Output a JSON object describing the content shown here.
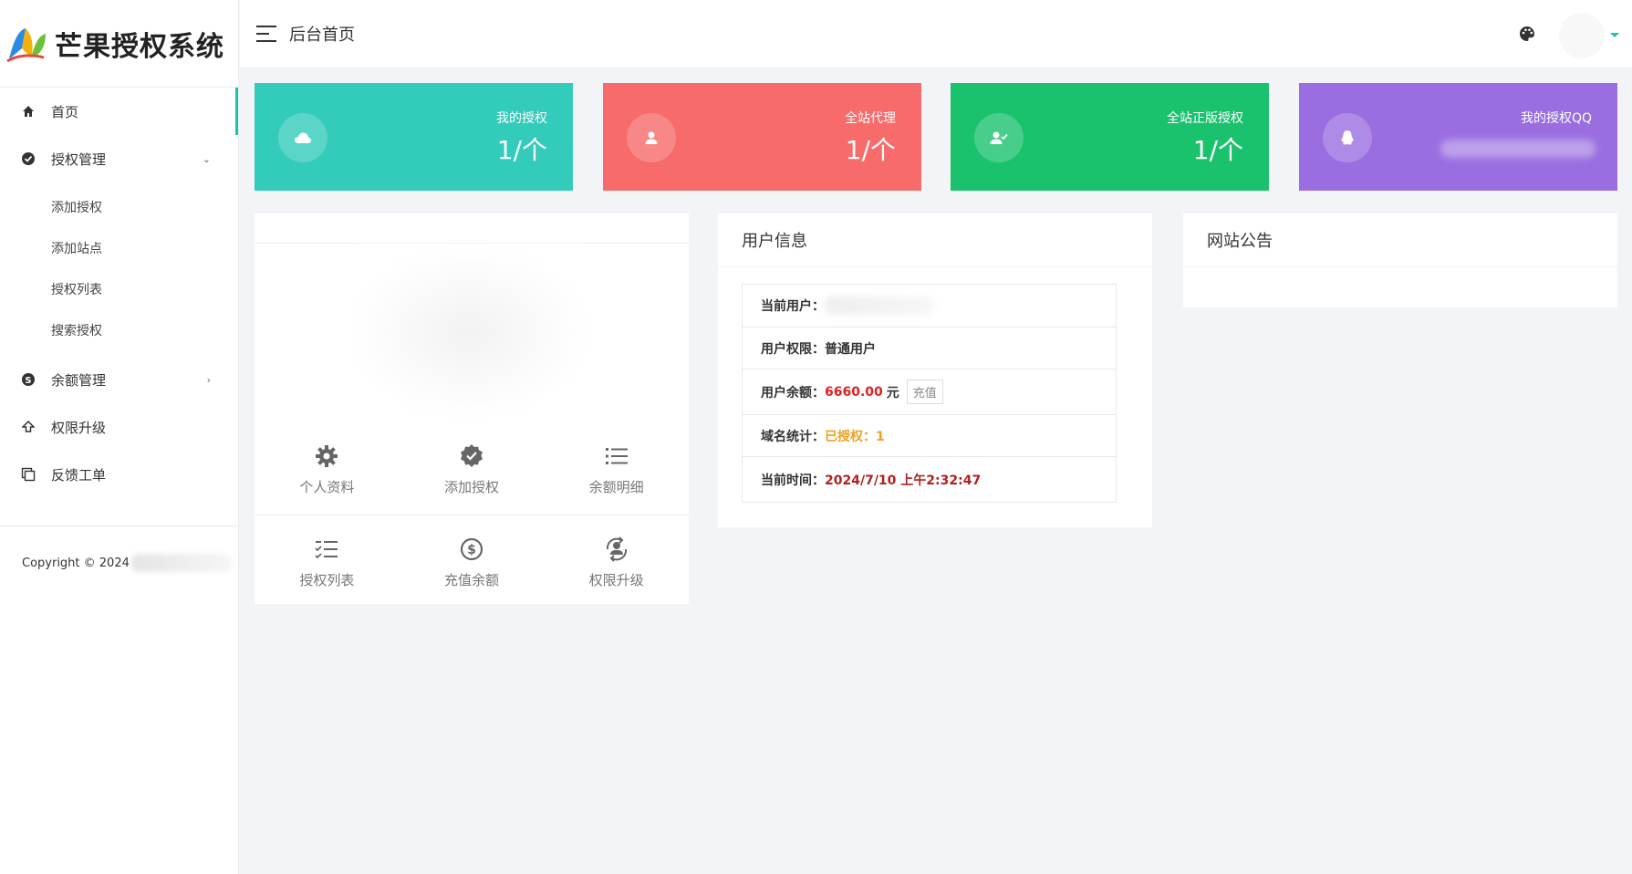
{
  "app": {
    "title": "芒果授权系统"
  },
  "sidebar": {
    "items": [
      {
        "label": "首页",
        "icon": "home-icon"
      },
      {
        "label": "授权管理",
        "icon": "verified-icon",
        "children": [
          "添加授权",
          "添加站点",
          "授权列表",
          "搜索授权"
        ]
      },
      {
        "label": "余额管理",
        "icon": "skype-icon"
      },
      {
        "label": "权限升级",
        "icon": "upgrade-icon"
      },
      {
        "label": "反馈工单",
        "icon": "copy-icon"
      }
    ],
    "copyright": "Copyright © 2024"
  },
  "header": {
    "title": "后台首页"
  },
  "stats": [
    {
      "label": "我的授权",
      "value": "1/个",
      "color": "#33cbba"
    },
    {
      "label": "全站代理",
      "value": "1/个",
      "color": "#f76b6b"
    },
    {
      "label": "全站正版授权",
      "value": "1/个",
      "color": "#1bc26e"
    },
    {
      "label": "我的授权QQ",
      "value": "",
      "color": "#9a6ee0"
    }
  ],
  "quick": {
    "items": [
      "个人资料",
      "添加授权",
      "余额明细",
      "授权列表",
      "充值余额",
      "权限升级"
    ]
  },
  "user_info": {
    "title": "用户信息",
    "current_user_label": "当前用户：",
    "role_label": "用户权限：",
    "role_value": "普通用户",
    "balance_label": "用户余额：",
    "balance_value": "6660.00",
    "balance_unit": "元",
    "recharge_label": "充值",
    "domain_label": "域名统计：",
    "domain_value": "已授权：1",
    "time_label": "当前时间：",
    "time_value": "2024/7/10 上午2:32:47"
  },
  "notice": {
    "title": "网站公告"
  },
  "colors": {
    "accent": "#1bc3b0",
    "red": "#e02020",
    "orange": "#f0a020"
  }
}
